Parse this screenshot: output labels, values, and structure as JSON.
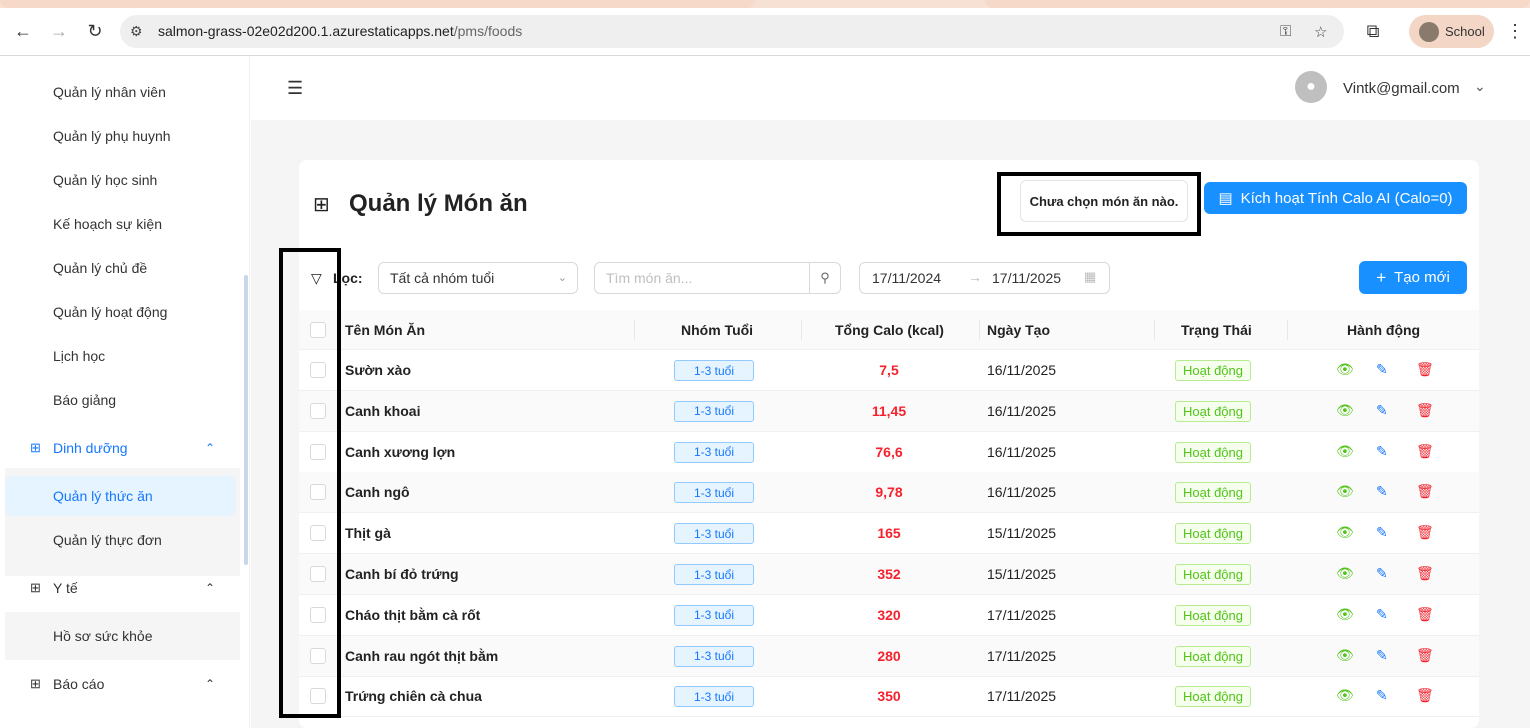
{
  "browser": {
    "url_host": "salmon-grass-02e02d200.1.azurestaticapps.net",
    "url_path": "/pms/foods",
    "profile_label": "School"
  },
  "sidebar": {
    "items": [
      {
        "label": "Quản lý nhân viên"
      },
      {
        "label": "Quản lý phụ huynh"
      },
      {
        "label": "Quản lý học sinh"
      },
      {
        "label": "Kế hoạch sự kiện"
      },
      {
        "label": "Quản lý chủ đề"
      },
      {
        "label": "Quản lý hoạt động"
      },
      {
        "label": "Lịch học"
      },
      {
        "label": "Báo giảng"
      }
    ],
    "groups": [
      {
        "label": "Dinh dưỡng",
        "children": [
          "Quản lý thức ăn",
          "Quản lý thực đơn"
        ]
      },
      {
        "label": "Y tế",
        "children": [
          "Hồ sơ sức khỏe"
        ]
      },
      {
        "label": "Báo cáo",
        "children": []
      }
    ]
  },
  "header": {
    "user_email": "Vintk@gmail.com"
  },
  "page": {
    "title": "Quản lý Món ăn",
    "empty_selection_note": "Chưa chọn món ăn nào.",
    "ai_button": "Kích hoạt Tính Calo AI (Calo=0)",
    "create_button": "Tạo mới",
    "filter_label": "Lọc:",
    "age_group_select": "Tất cả nhóm tuổi",
    "search_placeholder": "Tìm món ăn...",
    "date_from": "17/11/2024",
    "date_to": "17/11/2025"
  },
  "table": {
    "columns": [
      "Tên Món Ăn",
      "Nhóm Tuổi",
      "Tổng Calo (kcal)",
      "Ngày Tạo",
      "Trạng Thái",
      "Hành động"
    ],
    "rows": [
      {
        "name": "Sườn xào",
        "age": "1-3 tuổi",
        "calo": "7,5",
        "date": "16/11/2025",
        "status": "Hoạt động"
      },
      {
        "name": "Canh khoai",
        "age": "1-3 tuổi",
        "calo": "11,45",
        "date": "16/11/2025",
        "status": "Hoạt động"
      },
      {
        "name": "Canh xương lợn",
        "age": "1-3 tuổi",
        "calo": "76,6",
        "date": "16/11/2025",
        "status": "Hoạt động"
      },
      {
        "name": "Canh ngô",
        "age": "1-3 tuổi",
        "calo": "9,78",
        "date": "16/11/2025",
        "status": "Hoạt động"
      },
      {
        "name": "Thịt gà",
        "age": "1-3 tuổi",
        "calo": "165",
        "date": "15/11/2025",
        "status": "Hoạt động"
      },
      {
        "name": "Canh bí đỏ trứng",
        "age": "1-3 tuổi",
        "calo": "352",
        "date": "15/11/2025",
        "status": "Hoạt động"
      },
      {
        "name": "Cháo thịt bằm cà rốt",
        "age": "1-3 tuổi",
        "calo": "320",
        "date": "17/11/2025",
        "status": "Hoạt động"
      },
      {
        "name": "Canh rau ngót thịt bằm",
        "age": "1-3 tuổi",
        "calo": "280",
        "date": "17/11/2025",
        "status": "Hoạt động"
      },
      {
        "name": "Trứng chiên cà chua",
        "age": "1-3 tuổi",
        "calo": "350",
        "date": "17/11/2025",
        "status": "Hoạt động"
      }
    ]
  },
  "colors": {
    "primary": "#1890ff",
    "calo_red": "#f5222d",
    "status_green": "#52c41a"
  }
}
